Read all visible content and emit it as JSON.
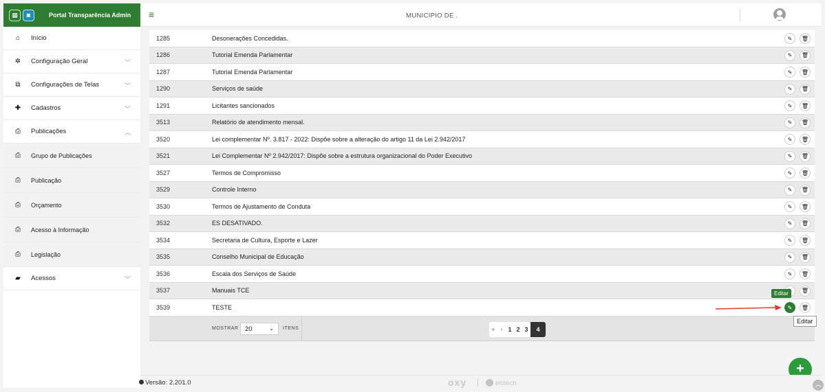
{
  "brand": {
    "title": "Portal Transparência Admin"
  },
  "header": {
    "municipio": "MUNICIPIO DE ."
  },
  "sidebar": {
    "items": [
      {
        "label": "Início",
        "icon": "home-icon"
      },
      {
        "label": "Configuração Geral",
        "icon": "gear-icon"
      },
      {
        "label": "Configurações de Telas",
        "icon": "windows-icon"
      },
      {
        "label": "Cadastros",
        "icon": "plus-icon"
      },
      {
        "label": "Publicações",
        "icon": "printer-icon"
      }
    ],
    "subitems": [
      {
        "label": "Grupo de Publicações"
      },
      {
        "label": "Publicação"
      },
      {
        "label": "Orçamento"
      },
      {
        "label": "Acesso à Informação"
      },
      {
        "label": "Legislação"
      }
    ],
    "acessos": {
      "label": "Acessos"
    }
  },
  "rows": [
    {
      "id": "1285",
      "name": "Desonerações Concedidas."
    },
    {
      "id": "1286",
      "name": "Tutorial Emenda Parlamentar"
    },
    {
      "id": "1287",
      "name": "Tutorial Emenda Parlamentar"
    },
    {
      "id": "1290",
      "name": "Serviços de saúde"
    },
    {
      "id": "1291",
      "name": "Licitantes sancionados"
    },
    {
      "id": "3513",
      "name": "Relatório de atendimento mensal."
    },
    {
      "id": "3520",
      "name": "Lei complementar Nº. 3.817 - 2022: Dispõe sobre a alteração do artigo 11 da Lei 2.942/2017"
    },
    {
      "id": "3521",
      "name": "Lei Complementar Nº 2.942/2017: Dispõe sobre a estrutura organizacional do Poder Executivo"
    },
    {
      "id": "3527",
      "name": "Termos de Compromisso"
    },
    {
      "id": "3529",
      "name": "Controle Interno"
    },
    {
      "id": "3530",
      "name": "Termos de Ajustamento de Conduta"
    },
    {
      "id": "3532",
      "name": "ES DESATIVADO."
    },
    {
      "id": "3534",
      "name": "Secretaria de Cultura, Esporte e Lazer"
    },
    {
      "id": "3535",
      "name": "Conselho Municipal de Educação"
    },
    {
      "id": "3536",
      "name": "Escala dos Serviços de Saúde"
    },
    {
      "id": "3537",
      "name": "Manuais TCE"
    },
    {
      "id": "3539",
      "name": "TESTE"
    }
  ],
  "footer": {
    "mostrar": "MOSTRAR",
    "perpage": "20",
    "itens": "ITENS",
    "pages": [
      "1",
      "2",
      "3",
      "4"
    ],
    "first": "«",
    "prev": "‹"
  },
  "tooltips": {
    "green": "Editar",
    "box": "Editar"
  },
  "status": {
    "versao": "Versão: 2.201.0",
    "oxy": "oxy",
    "elotech": "elotech"
  },
  "fab": "+"
}
